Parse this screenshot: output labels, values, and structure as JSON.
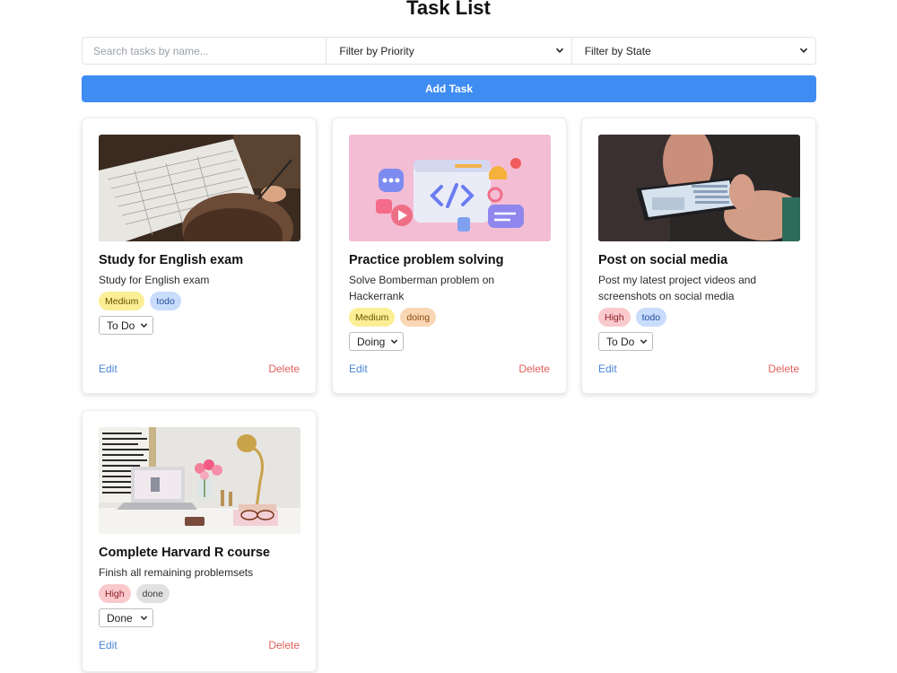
{
  "page": {
    "title": "Task List"
  },
  "toolbar": {
    "search_placeholder": "Search tasks by name...",
    "priority_filter": "Filter by Priority",
    "state_filter": "Filter by State",
    "add_button": "Add Task"
  },
  "colors": {
    "accent": "#3f8cf2",
    "edit_link": "#4a86d8",
    "delete_link": "#e0605c"
  },
  "tasks": [
    {
      "title": "Study for English exam",
      "description": "Study for English exam",
      "priority": "Medium",
      "state": "todo",
      "state_select": "To Do",
      "image": "person-writing-exam-paper",
      "edit": "Edit",
      "delete": "Delete"
    },
    {
      "title": "Practice problem solving",
      "description": "Solve Bomberman problem on Hackerrank",
      "priority": "Medium",
      "state": "doing",
      "state_select": "Doing",
      "image": "code-window-illustration",
      "edit": "Edit",
      "delete": "Delete"
    },
    {
      "title": "Post on social media",
      "description": "Post my latest project videos and screenshots on social media",
      "priority": "High",
      "state": "todo",
      "state_select": "To Do",
      "image": "hands-holding-smartphone",
      "edit": "Edit",
      "delete": "Delete"
    },
    {
      "title": "Complete Harvard R course",
      "description": "Finish all remaining problemsets",
      "priority": "High",
      "state": "done",
      "state_select": "Done",
      "image": "desk-with-laptop-and-lamp",
      "edit": "Edit",
      "delete": "Delete"
    }
  ]
}
